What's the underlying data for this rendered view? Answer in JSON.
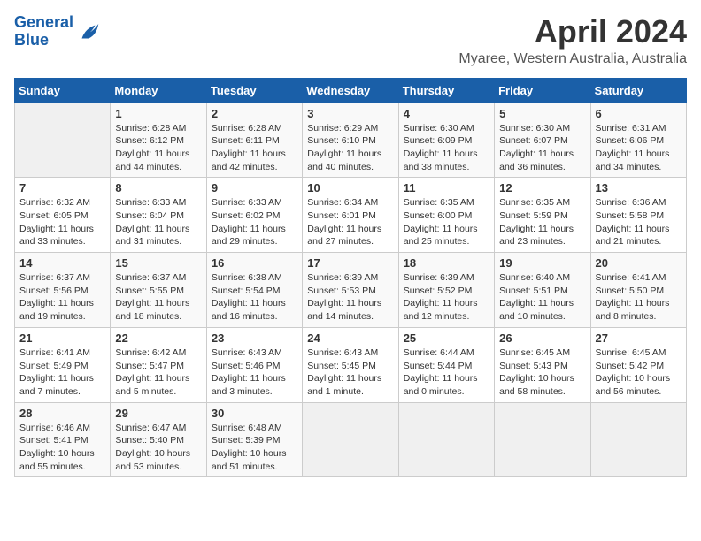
{
  "logo": {
    "line1": "General",
    "line2": "Blue"
  },
  "title": "April 2024",
  "subtitle": "Myaree, Western Australia, Australia",
  "days_header": [
    "Sunday",
    "Monday",
    "Tuesday",
    "Wednesday",
    "Thursday",
    "Friday",
    "Saturday"
  ],
  "weeks": [
    [
      {
        "day": "",
        "info": ""
      },
      {
        "day": "1",
        "info": "Sunrise: 6:28 AM\nSunset: 6:12 PM\nDaylight: 11 hours\nand 44 minutes."
      },
      {
        "day": "2",
        "info": "Sunrise: 6:28 AM\nSunset: 6:11 PM\nDaylight: 11 hours\nand 42 minutes."
      },
      {
        "day": "3",
        "info": "Sunrise: 6:29 AM\nSunset: 6:10 PM\nDaylight: 11 hours\nand 40 minutes."
      },
      {
        "day": "4",
        "info": "Sunrise: 6:30 AM\nSunset: 6:09 PM\nDaylight: 11 hours\nand 38 minutes."
      },
      {
        "day": "5",
        "info": "Sunrise: 6:30 AM\nSunset: 6:07 PM\nDaylight: 11 hours\nand 36 minutes."
      },
      {
        "day": "6",
        "info": "Sunrise: 6:31 AM\nSunset: 6:06 PM\nDaylight: 11 hours\nand 34 minutes."
      }
    ],
    [
      {
        "day": "7",
        "info": "Sunrise: 6:32 AM\nSunset: 6:05 PM\nDaylight: 11 hours\nand 33 minutes."
      },
      {
        "day": "8",
        "info": "Sunrise: 6:33 AM\nSunset: 6:04 PM\nDaylight: 11 hours\nand 31 minutes."
      },
      {
        "day": "9",
        "info": "Sunrise: 6:33 AM\nSunset: 6:02 PM\nDaylight: 11 hours\nand 29 minutes."
      },
      {
        "day": "10",
        "info": "Sunrise: 6:34 AM\nSunset: 6:01 PM\nDaylight: 11 hours\nand 27 minutes."
      },
      {
        "day": "11",
        "info": "Sunrise: 6:35 AM\nSunset: 6:00 PM\nDaylight: 11 hours\nand 25 minutes."
      },
      {
        "day": "12",
        "info": "Sunrise: 6:35 AM\nSunset: 5:59 PM\nDaylight: 11 hours\nand 23 minutes."
      },
      {
        "day": "13",
        "info": "Sunrise: 6:36 AM\nSunset: 5:58 PM\nDaylight: 11 hours\nand 21 minutes."
      }
    ],
    [
      {
        "day": "14",
        "info": "Sunrise: 6:37 AM\nSunset: 5:56 PM\nDaylight: 11 hours\nand 19 minutes."
      },
      {
        "day": "15",
        "info": "Sunrise: 6:37 AM\nSunset: 5:55 PM\nDaylight: 11 hours\nand 18 minutes."
      },
      {
        "day": "16",
        "info": "Sunrise: 6:38 AM\nSunset: 5:54 PM\nDaylight: 11 hours\nand 16 minutes."
      },
      {
        "day": "17",
        "info": "Sunrise: 6:39 AM\nSunset: 5:53 PM\nDaylight: 11 hours\nand 14 minutes."
      },
      {
        "day": "18",
        "info": "Sunrise: 6:39 AM\nSunset: 5:52 PM\nDaylight: 11 hours\nand 12 minutes."
      },
      {
        "day": "19",
        "info": "Sunrise: 6:40 AM\nSunset: 5:51 PM\nDaylight: 11 hours\nand 10 minutes."
      },
      {
        "day": "20",
        "info": "Sunrise: 6:41 AM\nSunset: 5:50 PM\nDaylight: 11 hours\nand 8 minutes."
      }
    ],
    [
      {
        "day": "21",
        "info": "Sunrise: 6:41 AM\nSunset: 5:49 PM\nDaylight: 11 hours\nand 7 minutes."
      },
      {
        "day": "22",
        "info": "Sunrise: 6:42 AM\nSunset: 5:47 PM\nDaylight: 11 hours\nand 5 minutes."
      },
      {
        "day": "23",
        "info": "Sunrise: 6:43 AM\nSunset: 5:46 PM\nDaylight: 11 hours\nand 3 minutes."
      },
      {
        "day": "24",
        "info": "Sunrise: 6:43 AM\nSunset: 5:45 PM\nDaylight: 11 hours\nand 1 minute."
      },
      {
        "day": "25",
        "info": "Sunrise: 6:44 AM\nSunset: 5:44 PM\nDaylight: 11 hours\nand 0 minutes."
      },
      {
        "day": "26",
        "info": "Sunrise: 6:45 AM\nSunset: 5:43 PM\nDaylight: 10 hours\nand 58 minutes."
      },
      {
        "day": "27",
        "info": "Sunrise: 6:45 AM\nSunset: 5:42 PM\nDaylight: 10 hours\nand 56 minutes."
      }
    ],
    [
      {
        "day": "28",
        "info": "Sunrise: 6:46 AM\nSunset: 5:41 PM\nDaylight: 10 hours\nand 55 minutes."
      },
      {
        "day": "29",
        "info": "Sunrise: 6:47 AM\nSunset: 5:40 PM\nDaylight: 10 hours\nand 53 minutes."
      },
      {
        "day": "30",
        "info": "Sunrise: 6:48 AM\nSunset: 5:39 PM\nDaylight: 10 hours\nand 51 minutes."
      },
      {
        "day": "",
        "info": ""
      },
      {
        "day": "",
        "info": ""
      },
      {
        "day": "",
        "info": ""
      },
      {
        "day": "",
        "info": ""
      }
    ]
  ]
}
